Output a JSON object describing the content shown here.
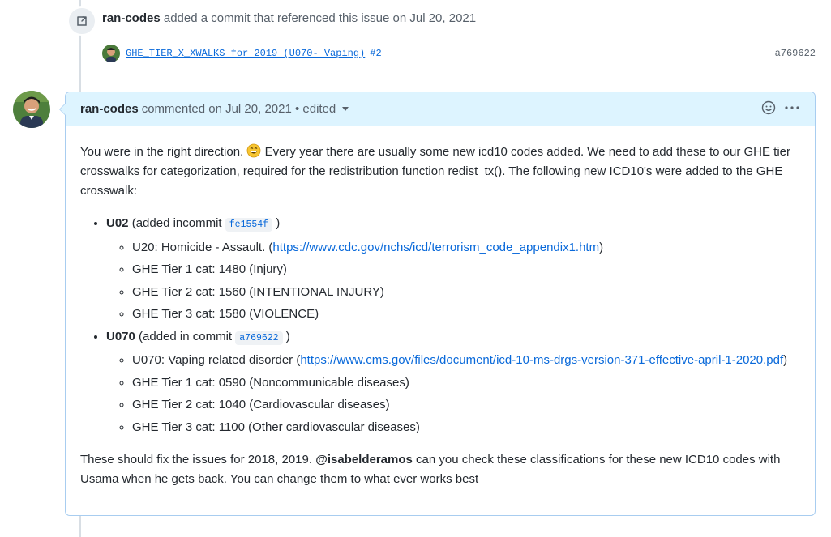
{
  "event": {
    "author": "ran-codes",
    "action": "added a commit that referenced this issue on Jul 20, 2021",
    "commit_message": "GHE_TIER_X_XWALKS for 2019 (U070- Vaping)",
    "commit_pr": "#2",
    "commit_sha": "a769622"
  },
  "comment": {
    "author": "ran-codes",
    "meta": "commented on Jul 20, 2021 • edited",
    "intro_part1": "You were in the right direction.",
    "intro_part2": "Every year there are usually some new icd10 codes added. We need to add these to our GHE tier crosswalks for categorization, required for the redistribution function redist_tx(). The following new ICD10's were added to the GHE crosswalk:",
    "items": [
      {
        "code": "U02",
        "prefix": "(added incommit",
        "commit": "fe1554f",
        "suffix": ")",
        "subitems": [
          {
            "text": "U20: Homicide - Assault. (",
            "link": "https://www.cdc.gov/nchs/icd/terrorism_code_appendix1.htm",
            "after": ")"
          },
          {
            "text": "GHE Tier 1 cat: 1480 (Injury)"
          },
          {
            "text": "GHE Tier 2 cat: 1560 (INTENTIONAL INJURY)"
          },
          {
            "text": "GHE Tier 3 cat: 1580 (VIOLENCE)"
          }
        ]
      },
      {
        "code": "U070",
        "prefix": "(added in commit",
        "commit": "a769622",
        "suffix": ")",
        "subitems": [
          {
            "text": "U070: Vaping related disorder (",
            "link": "https://www.cms.gov/files/document/icd-10-ms-drgs-version-371-effective-april-1-2020.pdf",
            "after": ")"
          },
          {
            "text": "GHE Tier 1 cat: 0590 (Noncommunicable diseases)"
          },
          {
            "text": "GHE Tier 2 cat: 1040 (Cardiovascular diseases)"
          },
          {
            "text": "GHE Tier 3 cat: 1100 (Other cardiovascular diseases)"
          }
        ]
      }
    ],
    "outro_part1": "These should fix the issues for 2018, 2019.",
    "mention": "@isabelderamos",
    "outro_part2": "can you check these classifications for these new ICD10 codes with Usama when he gets back. You can change them to what ever works best"
  },
  "icons": [
    "cross-reference-icon",
    "avatar",
    "grinning-face-emoji",
    "smiley-reaction-icon",
    "kebab-menu-icon",
    "dropdown-caret-icon"
  ]
}
